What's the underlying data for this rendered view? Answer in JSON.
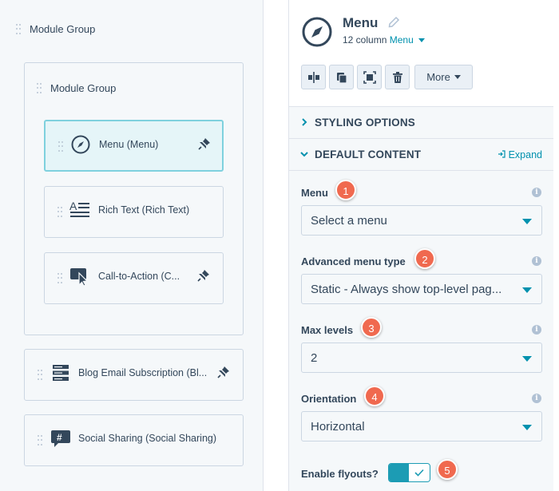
{
  "left": {
    "outer_group_label": "Module Group",
    "inner_group_label": "Module Group",
    "modules": [
      {
        "label": "Menu (Menu)",
        "icon": "compass-icon",
        "pinned": true,
        "active": true
      },
      {
        "label": "Rich Text (Rich Text)",
        "icon": "rich-text-icon",
        "pinned": false,
        "active": false
      },
      {
        "label": "Call-to-Action (C...",
        "icon": "cta-cursor-icon",
        "pinned": true,
        "active": false
      }
    ],
    "standalone_modules": [
      {
        "label": "Blog Email Subscription (Bl...",
        "icon": "form-icon",
        "pinned": true
      },
      {
        "label": "Social Sharing (Social Sharing)",
        "icon": "hashtag-icon",
        "pinned": false
      }
    ]
  },
  "right": {
    "title": "Menu",
    "subtitle_prefix": "12 column",
    "subtitle_link": "Menu",
    "toolbar": {
      "more_label": "More",
      "buttons": [
        "split-icon",
        "duplicate-icon",
        "select-icon",
        "trash-icon"
      ]
    },
    "sections": {
      "styling": "STYLING OPTIONS",
      "default_content": "DEFAULT CONTENT",
      "expand": "Expand"
    },
    "fields": {
      "menu": {
        "label": "Menu",
        "value": "Select a menu",
        "badge": "1"
      },
      "advanced_menu_type": {
        "label": "Advanced menu type",
        "value": "Static - Always show top-level pag...",
        "badge": "2"
      },
      "max_levels": {
        "label": "Max levels",
        "value": "2",
        "badge": "3"
      },
      "orientation": {
        "label": "Orientation",
        "value": "Horizontal",
        "badge": "4"
      },
      "flyouts": {
        "label": "Enable flyouts?",
        "enabled": true,
        "badge": "5"
      }
    }
  },
  "colors": {
    "accent": "#0091ae",
    "toggle": "#1c9cb4",
    "badge": "#f0694f",
    "active_module_bg": "#e5f5f8",
    "active_module_border": "#7fd1de"
  }
}
